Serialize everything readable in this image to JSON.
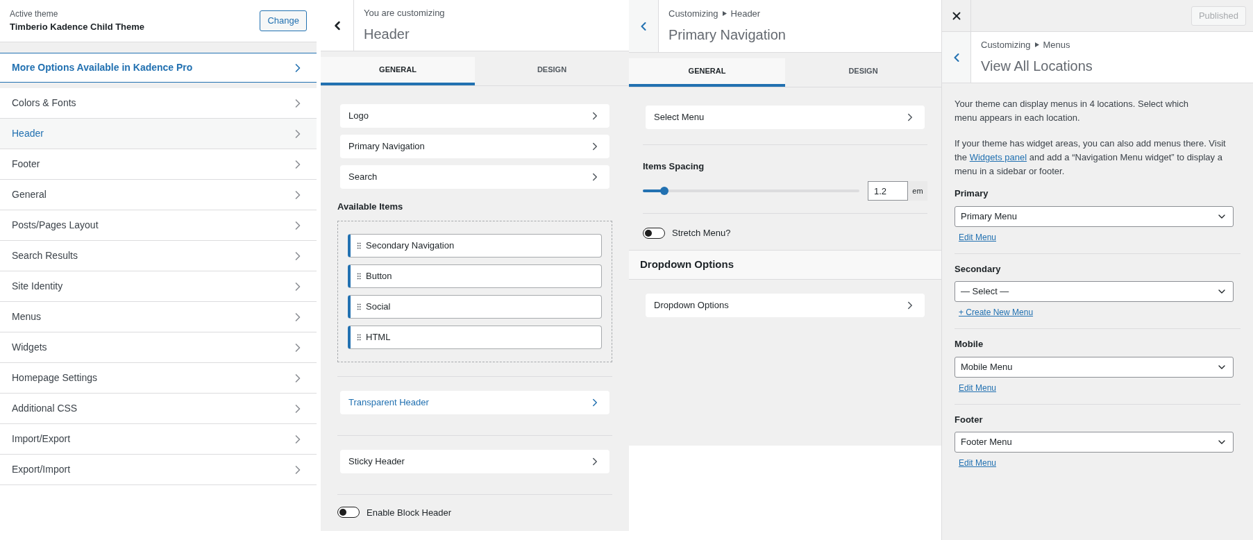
{
  "themes_panel": {
    "active_label": "Active theme",
    "theme_name": "Timberio Kadence Child Theme",
    "change_button": "Change",
    "pro_link": "More Options Available in Kadence Pro",
    "sections": [
      {
        "label": "Colors & Fonts",
        "selected": false
      },
      {
        "label": "Header",
        "selected": true
      },
      {
        "label": "Footer",
        "selected": false
      },
      {
        "label": "General",
        "selected": false
      },
      {
        "label": "Posts/Pages Layout",
        "selected": false
      },
      {
        "label": "Search Results",
        "selected": false
      },
      {
        "label": "Site Identity",
        "selected": false
      },
      {
        "label": "Menus",
        "selected": false
      },
      {
        "label": "Widgets",
        "selected": false
      },
      {
        "label": "Homepage Settings",
        "selected": false
      },
      {
        "label": "Additional CSS",
        "selected": false
      },
      {
        "label": "Import/Export",
        "selected": false
      },
      {
        "label": "Export/Import",
        "selected": false
      }
    ]
  },
  "header_panel": {
    "subtitle": "You are customizing",
    "title": "Header",
    "tabs": [
      {
        "label": "GENERAL",
        "selected": true
      },
      {
        "label": "DESIGN",
        "selected": false
      }
    ],
    "items": [
      "Logo",
      "Primary Navigation",
      "Search"
    ],
    "available_heading": "Available Items",
    "available_items": [
      "Secondary Navigation",
      "Button",
      "Social",
      "HTML"
    ],
    "extra_items": [
      {
        "label": "Transparent Header",
        "highlighted": true
      },
      {
        "label": "Sticky Header",
        "highlighted": false
      }
    ],
    "toggle": {
      "label": "Enable Block Header",
      "on": false
    }
  },
  "nav_panel": {
    "breadcrumb": [
      "Customizing",
      "Header"
    ],
    "title": "Primary Navigation",
    "tabs": [
      {
        "label": "GENERAL",
        "selected": true
      },
      {
        "label": "DESIGN",
        "selected": false
      }
    ],
    "select_menu": "Select Menu",
    "spacing": {
      "label": "Items Spacing",
      "level": 0.1,
      "value": "1.2",
      "unit": "em"
    },
    "toggle": {
      "label": "Stretch Menu?",
      "on": false
    },
    "section_title": "Dropdown Options",
    "section_item": "Dropdown Options"
  },
  "menus_panel": {
    "publish_button": {
      "label": "Published",
      "disabled": true
    },
    "breadcrumb": [
      "Customizing",
      "Menus"
    ],
    "title": "View All Locations",
    "intro": "Your theme can display menus in 4 locations. Select which menu appears in each location.",
    "widgets_note": {
      "before": "If your theme has widget areas, you can also add menus there. Visit the",
      "link": "Widgets panel",
      "after": "and add a “Navigation Menu widget” to display a menu in a sidebar or footer."
    },
    "locations": [
      {
        "label": "Primary",
        "value": "Primary Menu",
        "link": "Edit Menu"
      },
      {
        "label": "Secondary",
        "value": "— Select —",
        "link": "+ Create New Menu"
      },
      {
        "label": "Mobile",
        "value": "Mobile Menu",
        "link": "Edit Menu"
      },
      {
        "label": "Footer",
        "value": "Footer Menu",
        "link": "Edit Menu"
      }
    ]
  }
}
